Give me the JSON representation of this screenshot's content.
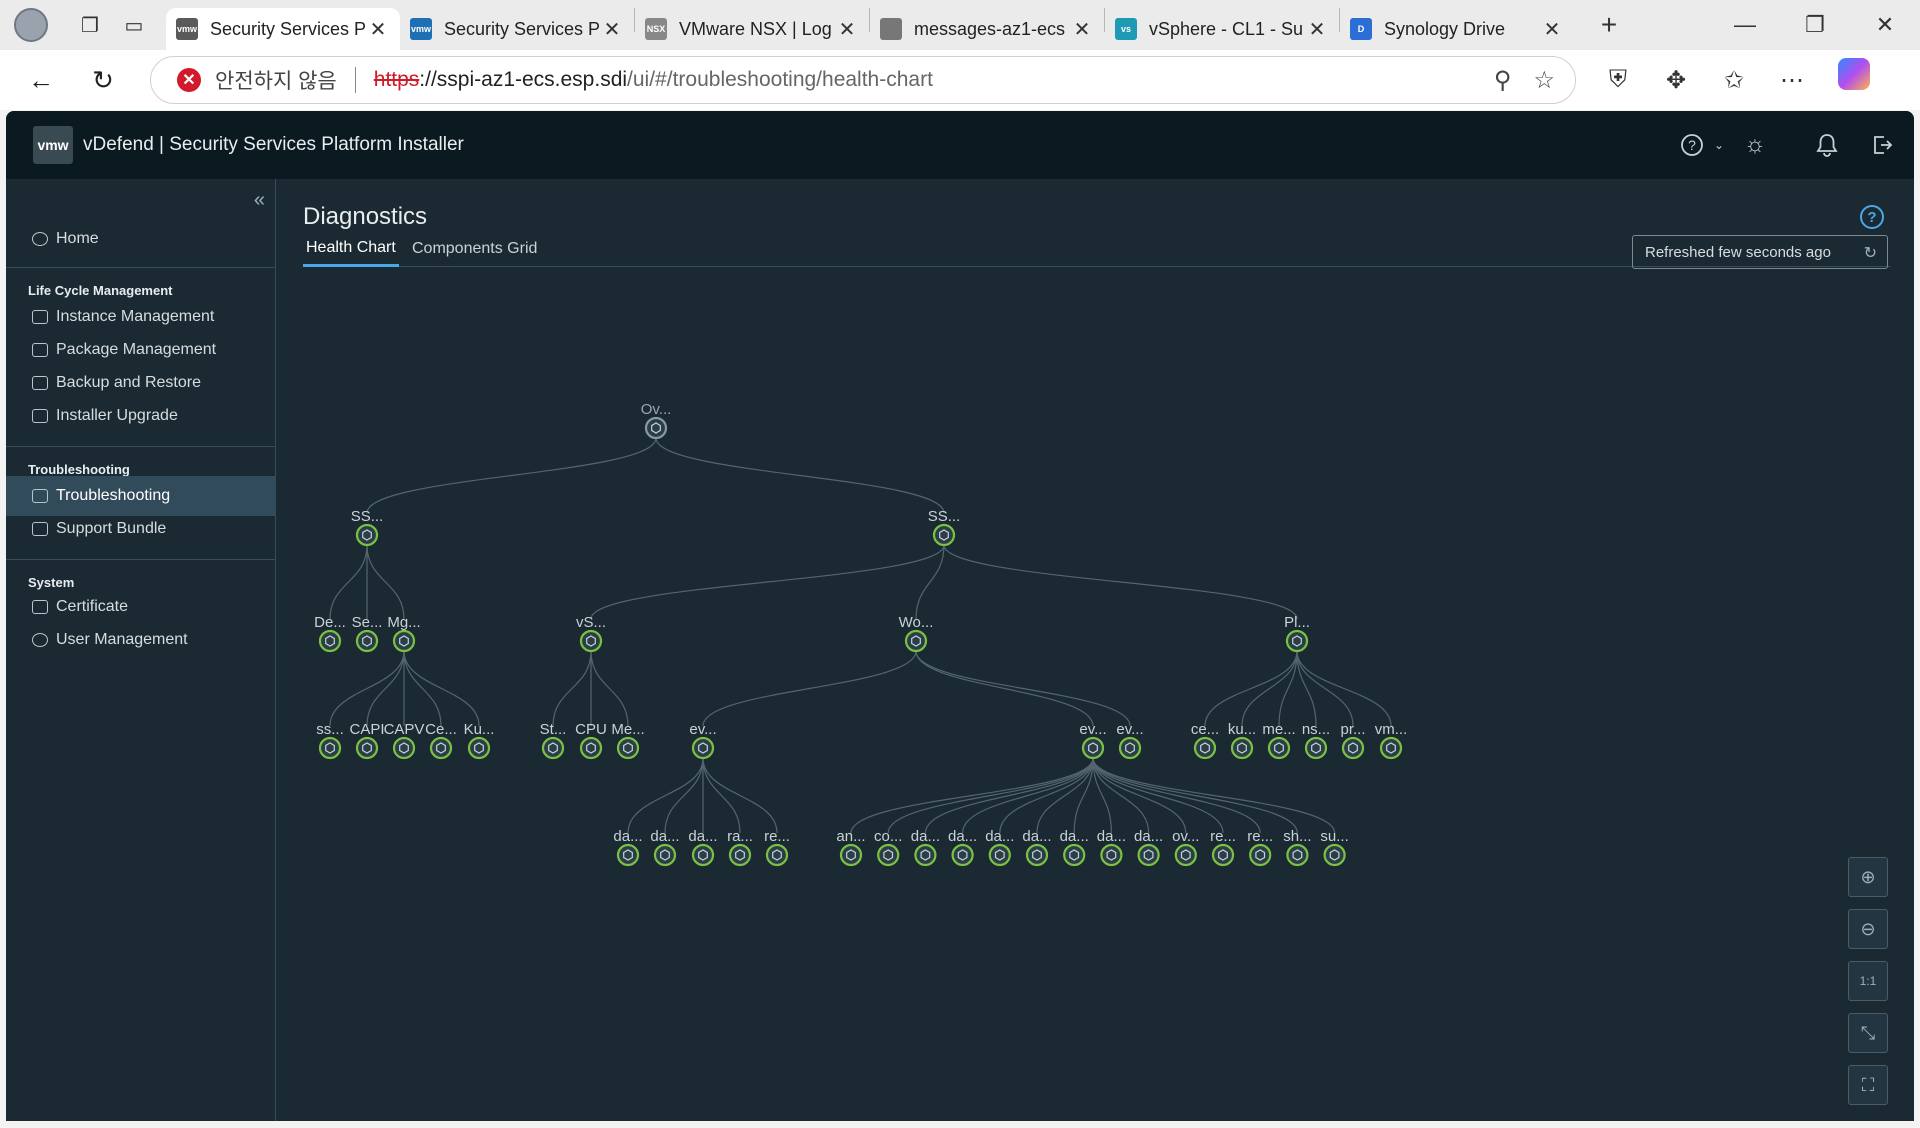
{
  "browser": {
    "tabs": [
      {
        "title": "Security Services P",
        "favicon": "vmw",
        "fav_color": "#5a5a5a",
        "active": true
      },
      {
        "title": "Security Services P",
        "favicon": "vmw",
        "fav_color": "#1f6fb5",
        "active": false
      },
      {
        "title": "VMware NSX | Log",
        "favicon": "NSX",
        "fav_color": "#888888",
        "active": false
      },
      {
        "title": "messages-az1-ecs",
        "favicon": "file",
        "fav_color": "#777777",
        "active": false
      },
      {
        "title": "vSphere - CL1 - Su",
        "favicon": "vs",
        "fav_color": "#1f9ab5",
        "active": false
      },
      {
        "title": "Synology Drive",
        "favicon": "D",
        "fav_color": "#2b6fd6",
        "active": false
      }
    ],
    "insecure_label": "안전하지 않음",
    "url_scheme": "https",
    "url_rest": "://sspi-az1-ecs.esp.sdi",
    "url_path": "/ui/#/troubleshooting/health-chart"
  },
  "app": {
    "logo": "vmw",
    "title": "vDefend | Security Services Platform Installer"
  },
  "sidebar": {
    "items": [
      {
        "label": "Home",
        "name": "sidebar-item-home"
      },
      {
        "label": "Instance Management",
        "name": "sidebar-item-instance-management"
      },
      {
        "label": "Package Management",
        "name": "sidebar-item-package-management"
      },
      {
        "label": "Backup and Restore",
        "name": "sidebar-item-backup-restore"
      },
      {
        "label": "Installer Upgrade",
        "name": "sidebar-item-installer-upgrade"
      },
      {
        "label": "Troubleshooting",
        "name": "sidebar-item-troubleshooting"
      },
      {
        "label": "Support Bundle",
        "name": "sidebar-item-support-bundle"
      },
      {
        "label": "Certificate",
        "name": "sidebar-item-certificate"
      },
      {
        "label": "User Management",
        "name": "sidebar-item-user-management"
      }
    ],
    "sections": [
      "Life Cycle Management",
      "Troubleshooting",
      "System"
    ]
  },
  "page": {
    "title": "Diagnostics",
    "tabs": [
      "Health Chart",
      "Components Grid"
    ],
    "refresh_label": "Refreshed few seconds ago"
  },
  "tree": {
    "status_color": "#7cc242",
    "root_color": "#8a9aa3",
    "nodes": [
      {
        "id": "root",
        "label": "Ov...",
        "status": "unknown"
      },
      {
        "id": "s1",
        "label": "SS...",
        "parent": "root"
      },
      {
        "id": "s2",
        "label": "SS...",
        "parent": "root"
      },
      {
        "id": "a1",
        "label": "De...",
        "parent": "s1"
      },
      {
        "id": "a2",
        "label": "Se...",
        "parent": "s1"
      },
      {
        "id": "a3",
        "label": "Mg...",
        "parent": "s1"
      },
      {
        "id": "b1",
        "label": "vS...",
        "parent": "s2"
      },
      {
        "id": "b2",
        "label": "Wo...",
        "parent": "s2"
      },
      {
        "id": "b3",
        "label": "Pl...",
        "parent": "s2"
      },
      {
        "id": "c1",
        "label": "ss...",
        "parent": "a3"
      },
      {
        "id": "c2",
        "label": "CAPI",
        "parent": "a3"
      },
      {
        "id": "c3",
        "label": "CAPV",
        "parent": "a3"
      },
      {
        "id": "c4",
        "label": "Ce...",
        "parent": "a3"
      },
      {
        "id": "c5",
        "label": "Ku...",
        "parent": "a3"
      },
      {
        "id": "d1",
        "label": "St...",
        "parent": "b1"
      },
      {
        "id": "d2",
        "label": "CPU",
        "parent": "b1"
      },
      {
        "id": "d3",
        "label": "Me...",
        "parent": "b1"
      },
      {
        "id": "e1",
        "label": "ev...",
        "parent": "b2"
      },
      {
        "id": "e2",
        "label": "ev...",
        "parent": "b2"
      },
      {
        "id": "e3",
        "label": "ev...",
        "parent": "b2"
      },
      {
        "id": "f1",
        "label": "ce...",
        "parent": "b3"
      },
      {
        "id": "f2",
        "label": "ku...",
        "parent": "b3"
      },
      {
        "id": "f3",
        "label": "me...",
        "parent": "b3"
      },
      {
        "id": "f4",
        "label": "ns...",
        "parent": "b3"
      },
      {
        "id": "f5",
        "label": "pr...",
        "parent": "b3"
      },
      {
        "id": "f6",
        "label": "vm...",
        "parent": "b3"
      },
      {
        "id": "g1",
        "label": "da...",
        "parent": "e1"
      },
      {
        "id": "g2",
        "label": "da...",
        "parent": "e1"
      },
      {
        "id": "g3",
        "label": "da...",
        "parent": "e1"
      },
      {
        "id": "g4",
        "label": "ra...",
        "parent": "e1"
      },
      {
        "id": "g5",
        "label": "re...",
        "parent": "e1"
      },
      {
        "id": "h1",
        "label": "an...",
        "parent": "e2"
      },
      {
        "id": "h2",
        "label": "co...",
        "parent": "e2"
      },
      {
        "id": "h3",
        "label": "da...",
        "parent": "e2"
      },
      {
        "id": "h4",
        "label": "da...",
        "parent": "e2"
      },
      {
        "id": "h5",
        "label": "da...",
        "parent": "e2"
      },
      {
        "id": "h6",
        "label": "da...",
        "parent": "e2"
      },
      {
        "id": "h7",
        "label": "da...",
        "parent": "e2"
      },
      {
        "id": "h8",
        "label": "da...",
        "parent": "e2"
      },
      {
        "id": "h9",
        "label": "da...",
        "parent": "e2"
      },
      {
        "id": "h10",
        "label": "ov...",
        "parent": "e2"
      },
      {
        "id": "h11",
        "label": "re...",
        "parent": "e2"
      },
      {
        "id": "h12",
        "label": "re...",
        "parent": "e2"
      },
      {
        "id": "h13",
        "label": "sh...",
        "parent": "e2"
      },
      {
        "id": "h14",
        "label": "su...",
        "parent": "e2"
      }
    ]
  },
  "zoom_controls": [
    "zoom-in-icon",
    "zoom-out-icon",
    "actual-size-icon",
    "collapse-icon",
    "fit-screen-icon"
  ]
}
